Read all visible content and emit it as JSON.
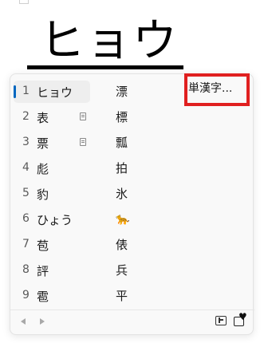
{
  "composition": {
    "text": "ヒョウ"
  },
  "candidates_column1": [
    {
      "num": "1",
      "text": "ヒョウ",
      "dict": false,
      "selected": true
    },
    {
      "num": "2",
      "text": "表",
      "dict": true,
      "selected": false
    },
    {
      "num": "3",
      "text": "票",
      "dict": true,
      "selected": false
    },
    {
      "num": "4",
      "text": "彪",
      "dict": false,
      "selected": false
    },
    {
      "num": "5",
      "text": "豹",
      "dict": false,
      "selected": false
    },
    {
      "num": "6",
      "text": "ひょう",
      "dict": false,
      "selected": false
    },
    {
      "num": "7",
      "text": "苞",
      "dict": false,
      "selected": false
    },
    {
      "num": "8",
      "text": "評",
      "dict": false,
      "selected": false
    },
    {
      "num": "9",
      "text": "雹",
      "dict": false,
      "selected": false
    }
  ],
  "candidates_column2": [
    "漂",
    "標",
    "瓢",
    "拍",
    "氷",
    "🐆",
    "俵",
    "兵",
    "平"
  ],
  "single_kanji_label": "単漢字...",
  "footer": {
    "prev_icon": "chevron-left-icon",
    "next_icon": "chevron-right-icon",
    "panel_icon": "candidate-panel-icon",
    "emoji_icon": "emoji-panel-icon",
    "emoji_glyph": "♥"
  },
  "colors": {
    "selection_accent": "#0067c0",
    "highlight_box": "#e02020"
  }
}
